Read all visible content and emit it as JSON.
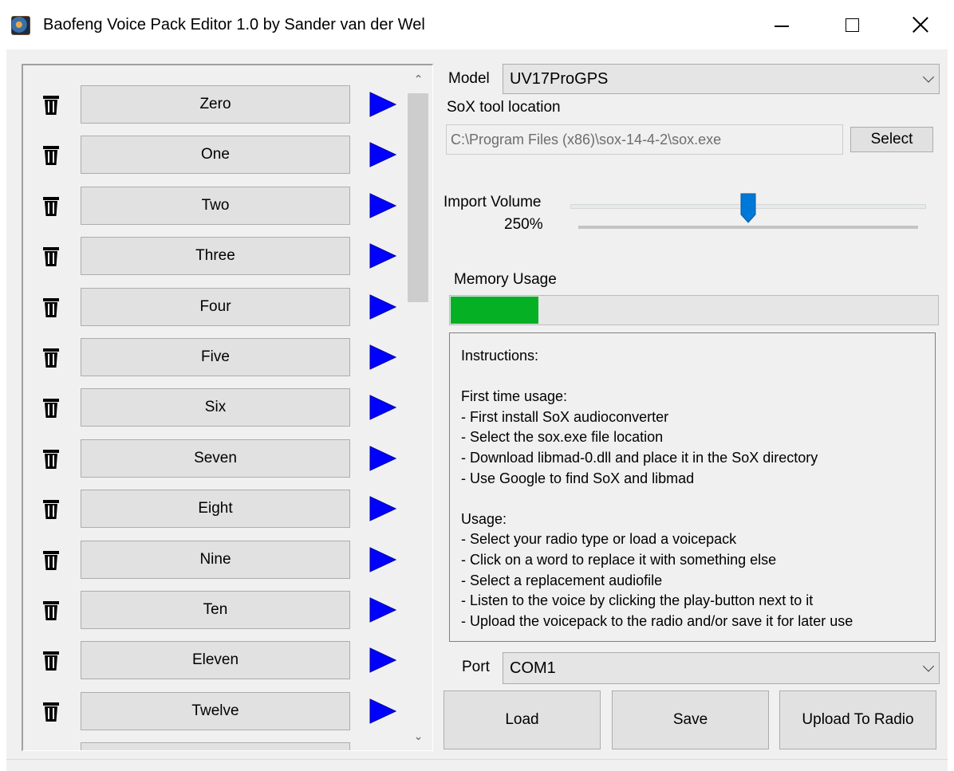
{
  "window": {
    "title": "Baofeng Voice Pack Editor 1.0 by Sander van der Wel"
  },
  "word_list": {
    "items": [
      "Zero",
      "One",
      "Two",
      "Three",
      "Four",
      "Five",
      "Six",
      "Seven",
      "Eight",
      "Nine",
      "Ten",
      "Eleven",
      "Twelve"
    ],
    "delete_icon": "trash-icon",
    "play_icon": "play-icon",
    "play_color": "#0000ff"
  },
  "model": {
    "label": "Model",
    "value": "UV17ProGPS"
  },
  "sox": {
    "label": "SoX tool location",
    "path": "C:\\Program Files (x86)\\sox-14-4-2\\sox.exe",
    "select_label": "Select"
  },
  "volume": {
    "label": "Import Volume",
    "value_text": "250%",
    "level_fraction": 0.5
  },
  "memory": {
    "label": "Memory Usage",
    "usage_fraction": 0.18,
    "bar_color": "#06b025"
  },
  "instructions": {
    "lines": [
      "Instructions:",
      "",
      "First time usage:",
      "- First install SoX audioconverter",
      "- Select the sox.exe file location",
      "- Download libmad-0.dll and place it in the SoX directory",
      "- Use Google to find SoX and libmad",
      "",
      "Usage:",
      "- Select your radio type or load a voicepack",
      "- Click on a word to replace it with something else",
      "- Select a replacement audiofile",
      "- Listen to the voice by clicking the play-button next to it",
      "- Upload the voicepack to the radio and/or save it for later use"
    ]
  },
  "port": {
    "label": "Port",
    "value": "COM1"
  },
  "actions": {
    "load_label": "Load",
    "save_label": "Save",
    "upload_label": "Upload To Radio"
  }
}
